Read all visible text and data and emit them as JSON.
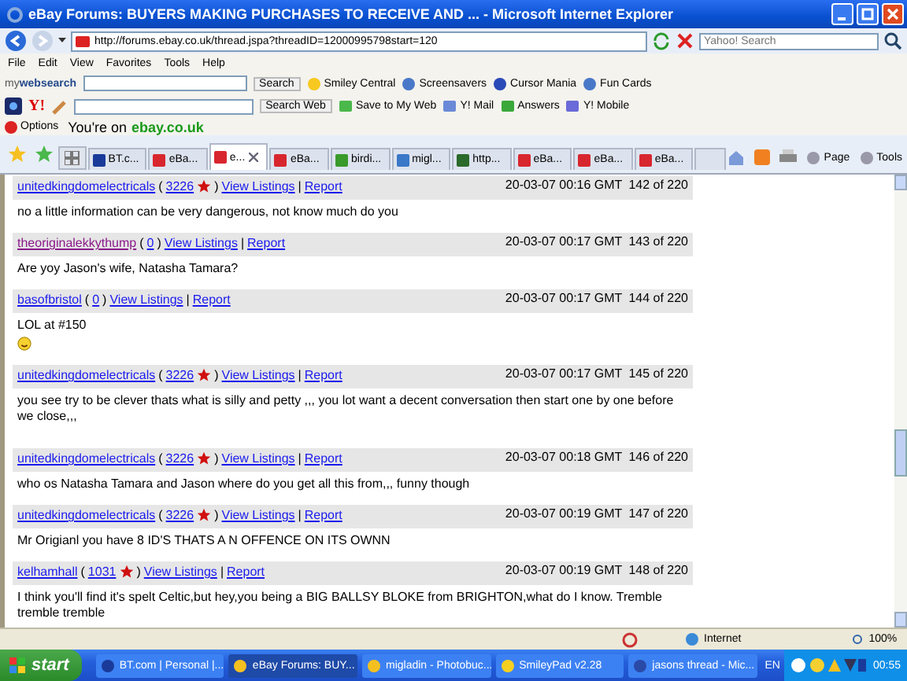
{
  "window": {
    "title": "eBay Forums: BUYERS MAKING PURCHASES TO RECEIVE AND ... - Microsoft Internet Explorer"
  },
  "address_bar": {
    "url": "http://forums.ebay.co.uk/thread.jspa?threadID=12000995798start=120",
    "search_placeholder": "Yahoo! Search"
  },
  "menu": [
    "File",
    "Edit",
    "View",
    "Favorites",
    "Tools",
    "Help"
  ],
  "mywebsearch_toolbar": {
    "logo": "my**websearch**",
    "search_button": "Search",
    "links": [
      "Smiley Central",
      "Screensavers",
      "Cursor Mania",
      "Fun Cards"
    ]
  },
  "yahoo_toolbar": {
    "logo": "Y!",
    "search_button": "Search Web",
    "buttons": [
      "Save to My Web",
      "Y! Mail",
      "Answers",
      "Y! Mobile"
    ]
  },
  "ebay_toolbar": {
    "options": "Options",
    "message": "You're on",
    "site": "ebay.co.uk"
  },
  "tabs": [
    {
      "label": "BT.c...",
      "selected": false,
      "kind": "bt"
    },
    {
      "label": "eBa...",
      "selected": false,
      "kind": "ebay"
    },
    {
      "label": "e...",
      "selected": true,
      "kind": "ebay"
    },
    {
      "label": "eBa...",
      "selected": false,
      "kind": "ebay"
    },
    {
      "label": "birdi...",
      "selected": false,
      "kind": "green"
    },
    {
      "label": "migl...",
      "selected": false,
      "kind": "photo"
    },
    {
      "label": "http...",
      "selected": false,
      "kind": "globe"
    },
    {
      "label": "eBa...",
      "selected": false,
      "kind": "ebay"
    },
    {
      "label": "eBa...",
      "selected": false,
      "kind": "ebay"
    },
    {
      "label": "eBa...",
      "selected": false,
      "kind": "ebay"
    }
  ],
  "command_bar": [
    "Page",
    "Tools"
  ],
  "posts": [
    {
      "user": "unitedkingdomelectricals",
      "visited": false,
      "open": "(",
      "feedback": "3226",
      "star": true,
      "close": ")",
      "view_listings": "View Listings",
      "sep": "|",
      "report": "Report",
      "time": "20-03-07 00:16 GMT",
      "number": "142 of 220",
      "body": "no a little information can be very dangerous, not know much do you",
      "smiley": false
    },
    {
      "user": "theoriginalekkythump",
      "visited": true,
      "open": "(",
      "feedback": "0",
      "star": false,
      "close": ")",
      "view_listings": "View Listings",
      "sep": "|",
      "report": "Report",
      "time": "20-03-07 00:17 GMT",
      "number": "143 of 220",
      "body": "Are yoy Jason's wife, Natasha Tamara?",
      "smiley": false
    },
    {
      "user": "basofbristol",
      "visited": false,
      "open": "(",
      "feedback": "0",
      "star": false,
      "close": ")",
      "view_listings": "View Listings",
      "sep": "|",
      "report": "Report",
      "time": "20-03-07 00:17 GMT",
      "number": "144 of 220",
      "body": "LOL at #150",
      "smiley": true
    },
    {
      "user": "unitedkingdomelectricals",
      "visited": false,
      "open": "(",
      "feedback": "3226",
      "star": true,
      "close": ")",
      "view_listings": "View Listings",
      "sep": "|",
      "report": "Report",
      "time": "20-03-07 00:17 GMT",
      "number": "145 of 220",
      "body": "you see try to be clever thats what is silly and petty ,,, you lot want a decent conversation then start one by one before we close,,,",
      "smiley": false
    },
    {
      "user": "unitedkingdomelectricals",
      "visited": false,
      "open": "(",
      "feedback": "3226",
      "star": true,
      "close": ")",
      "view_listings": "View Listings",
      "sep": "|",
      "report": "Report",
      "time": "20-03-07 00:18 GMT",
      "number": "146 of 220",
      "body": "who os Natasha Tamara and Jason where do you get all this from,,, funny though",
      "smiley": false
    },
    {
      "user": "unitedkingdomelectricals",
      "visited": false,
      "open": "(",
      "feedback": "3226",
      "star": true,
      "close": ")",
      "view_listings": "View Listings",
      "sep": "|",
      "report": "Report",
      "time": "20-03-07 00:19 GMT",
      "number": "147 of 220",
      "body": "Mr Origianl you have 8 ID'S THATS A N OFFENCE ON ITS OWNN",
      "smiley": false
    },
    {
      "user": "kelhamhall",
      "visited": false,
      "open": "(",
      "feedback": "1031",
      "star": true,
      "close": ")",
      "view_listings": "View Listings",
      "sep": "|",
      "report": "Report",
      "time": "20-03-07 00:19 GMT",
      "number": "148 of 220",
      "body": "I think you'll find it's spelt Celtic,but hey,you being a BIG BALLSY BLOKE from BRIGHTON,what do I know. Tremble tremble tremble",
      "smiley": false
    }
  ],
  "status_bar": {
    "zone": "Internet",
    "zoom": "100%"
  },
  "taskbar": {
    "start": "start",
    "tasks": [
      {
        "label": "BT.com | Personal |...",
        "selected": false,
        "kind": "bt"
      },
      {
        "label": "eBay Forums: BUY...",
        "selected": true,
        "kind": "ie"
      },
      {
        "label": "migladin - Photobuc...",
        "selected": false,
        "kind": "ie"
      },
      {
        "label": "SmileyPad v2.28",
        "selected": false,
        "kind": "smiley"
      },
      {
        "label": "jasons thread - Mic...",
        "selected": false,
        "kind": "word"
      }
    ],
    "language": "EN",
    "clock": "00:55"
  }
}
